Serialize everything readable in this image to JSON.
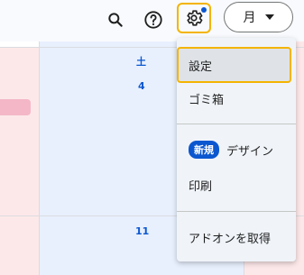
{
  "header": {
    "view_label": "月"
  },
  "calendar": {
    "days": [
      "土",
      "4",
      "11"
    ]
  },
  "menu": {
    "items": [
      {
        "label": "設定"
      },
      {
        "label": "ゴミ箱"
      },
      {
        "label": "デザイン",
        "badge": "新規"
      },
      {
        "label": "印刷"
      },
      {
        "label": "アドオンを取得"
      }
    ]
  },
  "icons": {
    "search": "search-icon",
    "help": "help-icon",
    "settings": "gear-icon",
    "dropdown": "caret-down-icon"
  },
  "colors": {
    "accent": "#0b57d0",
    "highlight": "#f4b400"
  }
}
